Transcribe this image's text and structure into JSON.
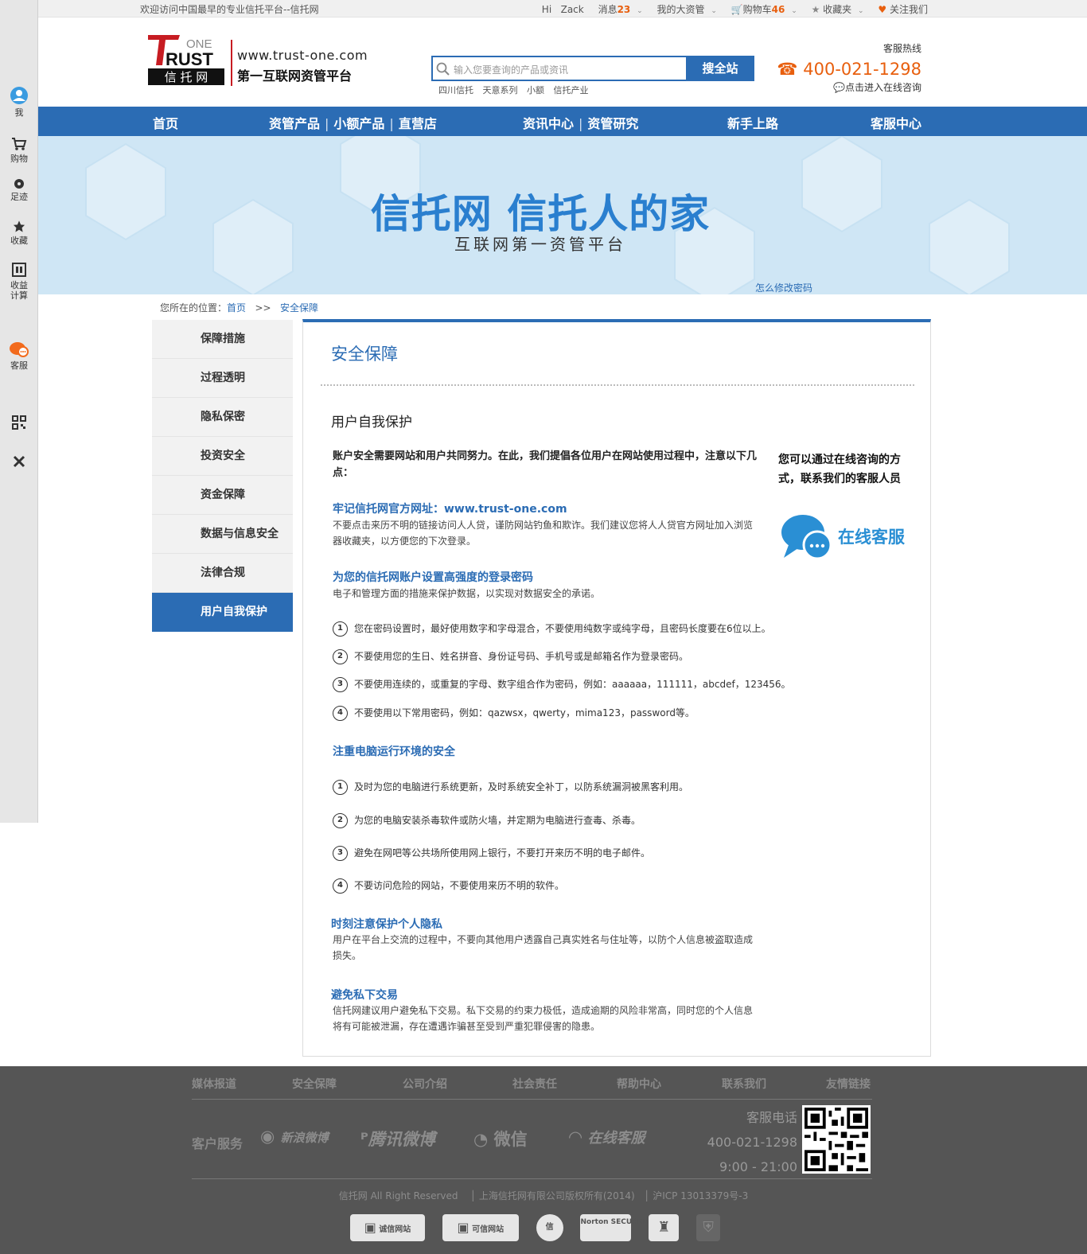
{
  "sidebar": {
    "items": [
      {
        "label": "我",
        "icon": "user-icon"
      },
      {
        "label": "购物",
        "icon": "cart-icon"
      },
      {
        "label": "足迹",
        "icon": "footprint-icon"
      },
      {
        "label": "收藏",
        "icon": "star-icon"
      },
      {
        "label": "收益\n计算",
        "line1": "收益",
        "line2": "计算",
        "icon": "calculator-icon"
      },
      {
        "label": "客服",
        "icon": "chat-icon"
      }
    ]
  },
  "topbar": {
    "welcome": "欢迎访问中国最早的专业信托平台--信托网",
    "hi": "Hi",
    "user": "Zack",
    "messages_label": "消息",
    "messages_count": "23",
    "my_assets": "我的大资管",
    "cart_label": "购物车",
    "cart_count": "46",
    "favorites": "收藏夹",
    "follow": "关注我们"
  },
  "header": {
    "logo_one": "ONE",
    "logo_rust": "RUST",
    "logo_cn": "信 托 网",
    "url": "www.trust-one.com",
    "slogan": "第一互联网资管平台",
    "search_placeholder": "输入您要查询的产品或资讯",
    "search_button": "搜全站",
    "hotwords": [
      "四川信托",
      "天意系列",
      "小额",
      "信托产业"
    ],
    "hotline_label": "客服热线",
    "hotline_number": "400-021-1298",
    "consult_link": "点击进入在线咨询"
  },
  "nav": {
    "home": "首页",
    "asset_products": "资管产品",
    "small_products": "小额产品",
    "direct_store": "直营店",
    "news": "资讯中心",
    "research": "资管研究",
    "newbie": "新手上路",
    "service": "客服中心"
  },
  "banner": {
    "title": "信托网 信托人的家",
    "subtitle": "互联网第一资管平台",
    "howto": "怎么修改密码"
  },
  "breadcrumb": {
    "prefix": "您所在的位置：",
    "home": "首页",
    "sep": ">>",
    "current": "安全保障"
  },
  "left_menu": [
    "保障措施",
    "过程透明",
    "隐私保密",
    "投资安全",
    "资金保障",
    "数据与信息安全",
    "法律合规",
    "用户自我保护"
  ],
  "content": {
    "title": "安全保障",
    "subtitle": "用户自我保护",
    "intro": "账户安全需要网站和用户共同努力。在此，我们提倡各位用户在网站使用过程中，注意以下几点：",
    "s1_title": "牢记信托网官方网址：www.trust-one.com",
    "s1_body": "不要点击来历不明的链接访问人人贷，谨防网站钓鱼和欺诈。我们建议您将人人贷官方网址加入浏览器收藏夹，以方便您的下次登录。",
    "s2_title": "为您的信托网账户设置高强度的登录密码",
    "s2_body": "电子和管理方面的措施来保护数据，以实现对数据安全的承诺。",
    "s2_items": [
      "您在密码设置时，最好使用数字和字母混合，不要使用纯数字或纯字母，且密码长度要在6位以上。",
      "不要使用您的生日、姓名拼音、身份证号码、手机号或是邮箱名作为登录密码。",
      "不要使用连续的，或重复的字母、数字组合作为密码，例如：aaaaaa，111111，abcdef，123456。",
      "不要使用以下常用密码，例如：qazwsx，qwerty，mima123，password等。"
    ],
    "s3_title": "注重电脑运行环境的安全",
    "s3_items": [
      "及时为您的电脑进行系统更新，及时系统安全补丁，以防系统漏洞被黑客利用。",
      "为您的电脑安装杀毒软件或防火墙，并定期为电脑进行查毒、杀毒。",
      "避免在网吧等公共场所使用网上银行，不要打开来历不明的电子邮件。",
      "不要访问危险的网站，不要使用来历不明的软件。"
    ],
    "s4_title": "时刻注意保护个人隐私",
    "s4_body": "用户在平台上交流的过程中，不要向其他用户透露自己真实姓名与住址等，以防个人信息被盗取造成损失。",
    "s5_title": "避免私下交易",
    "s5_body": "信托网建议用户避免私下交易。私下交易的约束力极低，造成逾期的风险非常高，同时您的个人信息将有可能被泄漏，存在遭遇诈骗甚至受到严重犯罪侵害的隐患。",
    "right_tip": "您可以通过在线咨询的方式，联系我们的客服人员",
    "online_service": "在线客服"
  },
  "footer": {
    "links": [
      "媒体报道",
      "安全保障",
      "公司介绍",
      "社会责任",
      "帮助中心",
      "联系我们",
      "友情链接"
    ],
    "customer_service": "客户服务",
    "social": [
      "新浪微博",
      "腾讯微博",
      "微信",
      "在线客服"
    ],
    "phone_label": "客服电话",
    "phone": "400-021-1298",
    "hours": "9:00 - 21:00",
    "copyright": "信托网 All Right Reserved",
    "company": "上海信托网有限公司版权所有(2014)",
    "icp": "沪ICP 13013379号-3",
    "badges": [
      "诚信网站",
      "可信网站",
      "信",
      "Norton SECURED"
    ]
  }
}
